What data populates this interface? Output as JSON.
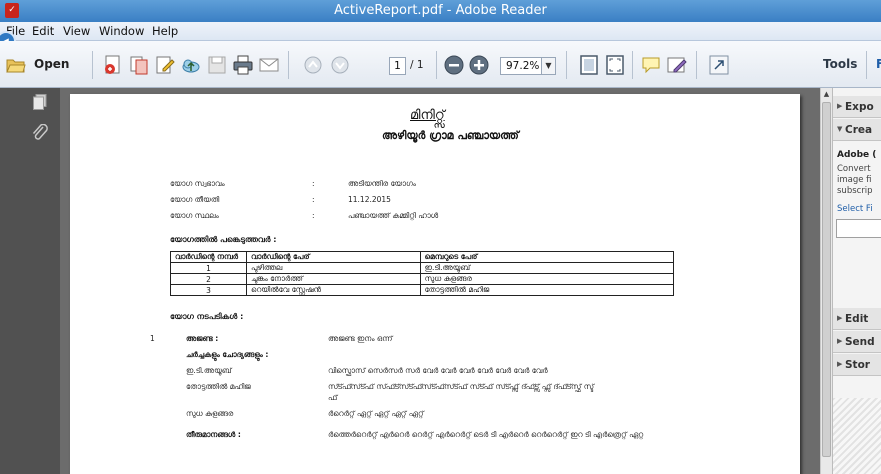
{
  "window": {
    "title": "ActiveReport.pdf - Adobe Reader",
    "logo": "adobe-reader-logo"
  },
  "menu": [
    "File",
    "Edit",
    "View",
    "Window",
    "Help"
  ],
  "toolbar": {
    "open_label": "Open",
    "page_current": "1",
    "page_total": "/ 1",
    "zoom": "97.2%",
    "tools_label": "Tools",
    "fill_sign_label": "F"
  },
  "task_pane": {
    "sections": [
      {
        "label": "Expo",
        "state": "collapsed"
      },
      {
        "label": "Crea",
        "state": "expanded"
      }
    ],
    "create_body": {
      "heading": "Adobe (",
      "lines": [
        "Convert",
        "image fi",
        "subscrip"
      ],
      "link": "Select Fi"
    },
    "bottom_sections": [
      {
        "label": "Edit"
      },
      {
        "label": "Send"
      },
      {
        "label": "Stor"
      }
    ]
  },
  "document": {
    "title": "മിനിറ്റ്സ്",
    "subtitle": "അഴിയൂർ   ഗ്രാമ പഞ്ചായത്ത്",
    "info": [
      {
        "label": "യോഗ സ്വഭാവം",
        "colon": ":",
        "value": "അടിയന്തിര യോഗം"
      },
      {
        "label": "യോഗ തീയതി",
        "colon": ":",
        "value": "11.12.2015"
      },
      {
        "label": "യോഗ സ്ഥലം",
        "colon": ":",
        "value": "പഞ്ചായത്ത് കമ്മിറ്റി ഹാൾ"
      }
    ],
    "attendees_heading": "യോഗത്തിൽ പങ്കെടുത്തവർ :",
    "table": {
      "headers": [
        "വാർഡിന്റെ നമ്പർ",
        "വാർഡിന്റെ പേര്",
        "മെമ്പറുടെ പേര്"
      ],
      "rows": [
        [
          "1",
          "പുഴിത്തല",
          "ഇ.ടി.അയൂബ്"
        ],
        [
          "2",
          "ചുങ്കം നോർത്ത്",
          "സുധ കുളങ്ങര"
        ],
        [
          "3",
          "റെയിൽവേ സ്റ്റേഷൻ",
          "തോട്ടത്തിൽ മഹിജ"
        ]
      ]
    },
    "proceedings_heading": "യോഗ നടപടികൾ :",
    "agenda_number": "1",
    "agenda_label": "അജണ്ട :",
    "agenda_value": "അജണ്ട ഇനം ഒന്ന്",
    "discussion_heading": "ചർച്ചകളും ചോദ്യങ്ങളും :",
    "discussions": [
      {
        "speaker": "ഇ.ടി.അയൂബ്",
        "text_lines": [
          "വിസ്ഫൊസ് സെർസർ സർ വേർ വേർ വേർ വേർ വേർ വേർ വേർ"
        ]
      },
      {
        "speaker": "തോട്ടത്തിൽ മഹിജ",
        "text_lines": [
          "സ്ട്ഫ്സ്ട്ഫ് സ്ഫ്ട്സ്ട്ഫ്സ്ട്ഫ്സ്ട്ഫ് സ്ട്ഫ് സ്ട്ഫ്സ് ദ്ഫ്ട്സ് ഫ്സ് ദ്ഫ്ട്സ്ഫ് സ്ട്",
          "ഫ്"
        ]
      },
      {
        "speaker": "സുധ കുളങ്ങര",
        "text_lines": [
          "ർറെർറ്റ് ഏറ്റ് ഏറ്റ് ഏറ്റ് ഏറ്റ്"
        ]
      }
    ],
    "decisions_label": "തീരുമാനങ്ങൾ :",
    "decisions_value": "ർത്തെർറെർറ്റ് എർറെർ റെർറ്റ് എർറെർറ്റ് ടെർ ടി എർറെർ റെർറെർറ്റ് ഇറ ടി എർത്രെറ്റ് ഏറ്റ"
  }
}
